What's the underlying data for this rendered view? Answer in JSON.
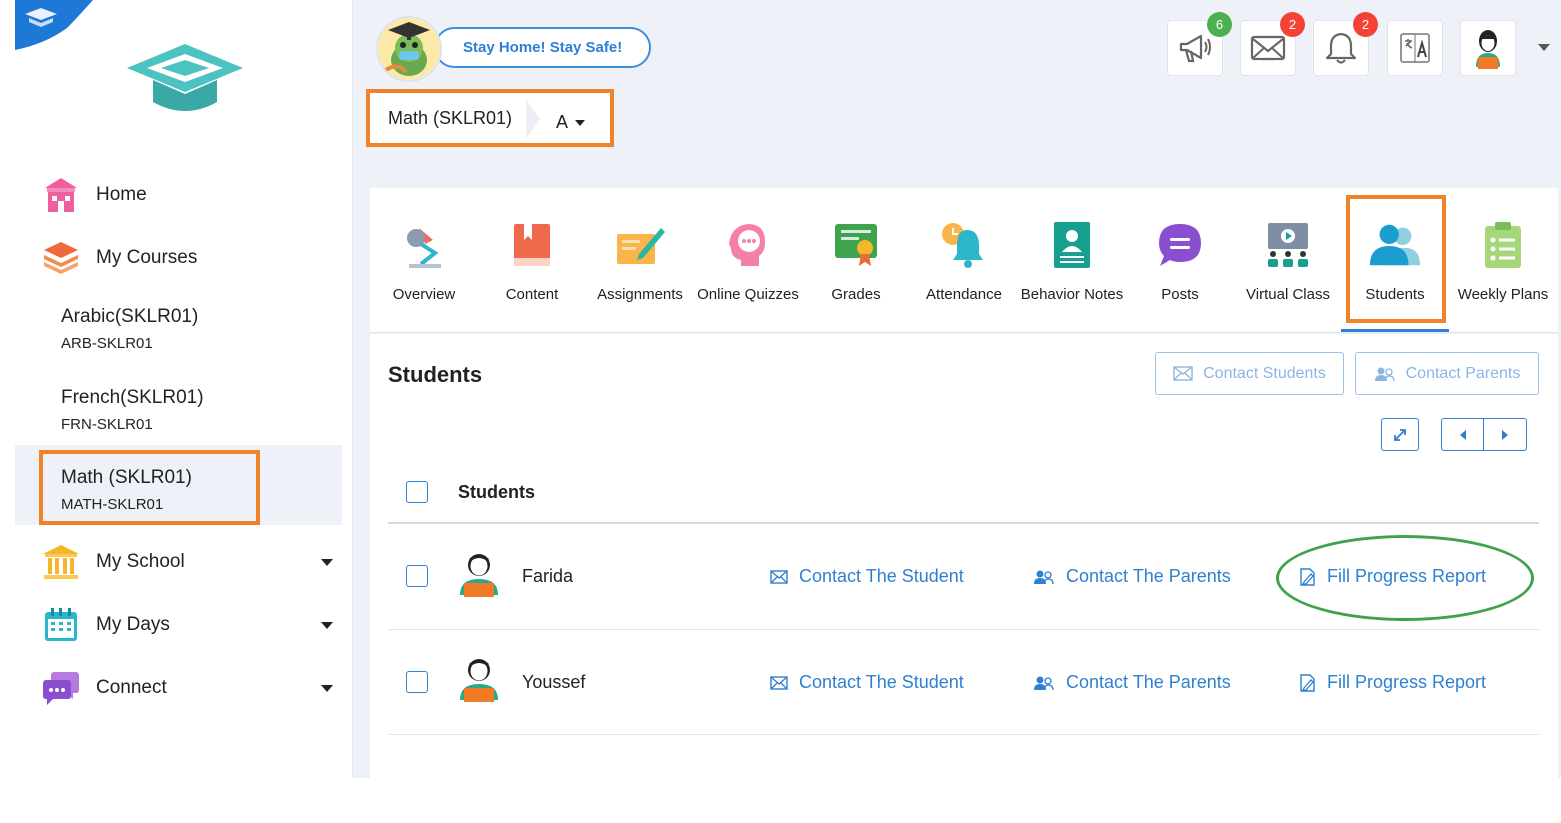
{
  "header": {
    "banner_text": "Stay Home! Stay Safe!",
    "course_selector": {
      "course": "Math (SKLR01)",
      "section": "A"
    },
    "badges": {
      "announcements": "6",
      "messages": "2",
      "notifications": "2"
    }
  },
  "sidebar": {
    "nav": [
      {
        "label": "Home"
      },
      {
        "label": "My Courses"
      },
      {
        "label": "My School"
      },
      {
        "label": "My Days"
      },
      {
        "label": "Connect"
      }
    ],
    "courses": [
      {
        "name": "Arabic(SKLR01)",
        "code": "ARB-SKLR01"
      },
      {
        "name": "French(SKLR01)",
        "code": "FRN-SKLR01"
      },
      {
        "name": "Math (SKLR01)",
        "code": "MATH-SKLR01"
      }
    ]
  },
  "tabs": [
    {
      "label": "Overview"
    },
    {
      "label": "Content"
    },
    {
      "label": "Assignments"
    },
    {
      "label": "Online Quizzes"
    },
    {
      "label": "Grades"
    },
    {
      "label": "Attendance"
    },
    {
      "label": "Behavior Notes"
    },
    {
      "label": "Posts"
    },
    {
      "label": "Virtual Class"
    },
    {
      "label": "Students"
    },
    {
      "label": "Weekly Plans"
    }
  ],
  "active_tab": "Students",
  "students_panel": {
    "title": "Students",
    "contact_students_label": "Contact Students",
    "contact_parents_label": "Contact Parents",
    "column_header": "Students",
    "rows": [
      {
        "name": "Farida",
        "contact_student": "Contact The Student",
        "contact_parents": "Contact The Parents",
        "progress_report": "Fill Progress Report"
      },
      {
        "name": "Youssef",
        "contact_student": "Contact The Student",
        "contact_parents": "Contact The Parents",
        "progress_report": "Fill Progress Report"
      }
    ]
  },
  "colors": {
    "accent": "#2f80d1",
    "highlight": "#f0822a",
    "annotation": "#3fa34d",
    "badge_green": "#4caf50",
    "badge_red": "#f44336"
  }
}
